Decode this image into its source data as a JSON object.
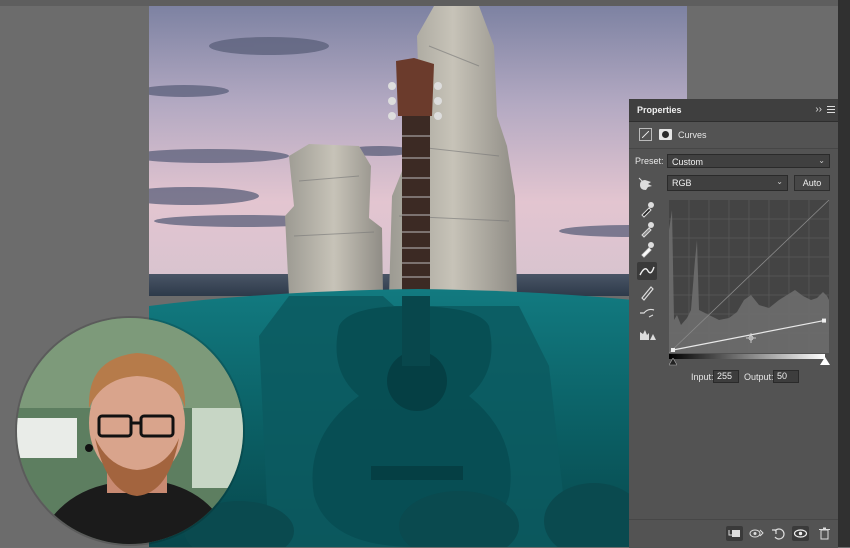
{
  "panel": {
    "title": "Properties",
    "collapse_glyph": "››",
    "menu_icon": "panel-menu-icon",
    "adjustment_label": "Curves",
    "preset_label": "Preset:",
    "preset_value": "Custom",
    "channel_value": "RGB",
    "auto_label": "Auto",
    "input_label": "Input:",
    "input_value": "255",
    "output_label": "Output:",
    "output_value": "50",
    "dropdown_arrow": "⌄",
    "tools": [
      "on-image-adjust-icon",
      "black-point-eyedropper-icon",
      "gray-point-eyedropper-icon",
      "white-point-eyedropper-icon",
      "curve-point-icon",
      "pencil-draw-icon",
      "smooth-curve-icon",
      "clipping-warning-icon"
    ],
    "footer_buttons": [
      "clip-to-layer-icon",
      "view-previous-state-icon",
      "reset-icon",
      "visibility-eye-icon",
      "trash-icon"
    ],
    "curve": {
      "points": [
        [
          0,
          0
        ],
        [
          255,
          50
        ]
      ]
    }
  },
  "colors": {
    "panel_bg": "#535353",
    "water": "#0f6a6e",
    "sky_top": "#7c81a0",
    "sky_bottom": "#e8c8d2"
  }
}
